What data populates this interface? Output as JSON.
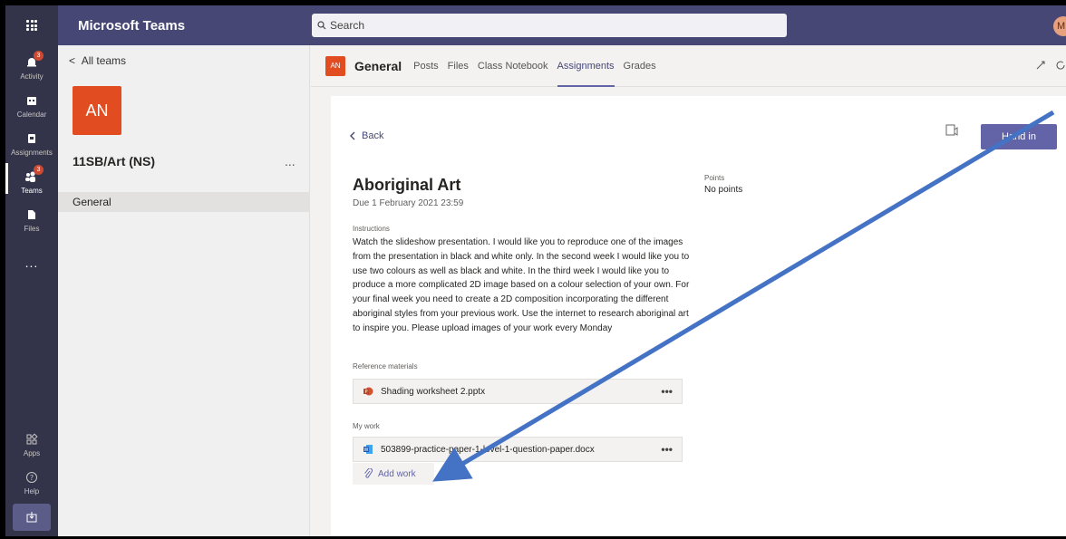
{
  "app": {
    "title": "Microsoft Teams",
    "user_initial": "M"
  },
  "search": {
    "placeholder": "Search"
  },
  "rail": {
    "items": [
      {
        "label": "Activity",
        "icon": "bell-icon",
        "badge": "3"
      },
      {
        "label": "Calendar",
        "icon": "calendar-icon"
      },
      {
        "label": "Assignments",
        "icon": "assignments-icon"
      },
      {
        "label": "Teams",
        "icon": "teams-icon",
        "badge": "3"
      },
      {
        "label": "Files",
        "icon": "files-icon"
      },
      {
        "label": "Apps",
        "icon": "apps-icon"
      },
      {
        "label": "Help",
        "icon": "help-icon"
      }
    ],
    "more": "...",
    "download_icon": "download-icon"
  },
  "team_panel": {
    "back_label": "All teams",
    "avatar": "AN",
    "team_name": "11SB/Art (NS)",
    "more": "...",
    "channel": "General"
  },
  "channel_header": {
    "avatar": "AN",
    "title": "General",
    "tabs": [
      "Posts",
      "Files",
      "Class Notebook",
      "Assignments",
      "Grades"
    ],
    "active_tab": "Assignments"
  },
  "assignment": {
    "back_label": "Back",
    "hand_in_label": "Hand in",
    "title": "Aboriginal Art",
    "due": "Due 1 February 2021 23:59",
    "points_label": "Points",
    "points_value": "No points",
    "instructions_label": "Instructions",
    "instructions": "Watch the slideshow presentation. I would like you to reproduce one of the images from the presentation in black and white only. In the second week I would like you to use  two colours as well as black and white. In the third week I would like you to produce a more complicated 2D image based on a colour selection of your own.  For your final week you need to create a 2D composition incorporating the different aboriginal styles from your previous work. Use the internet to research aboriginal art to inspire you. Please upload images of your work every Monday",
    "reference_label": "Reference materials",
    "reference_file": "Shading worksheet 2.pptx",
    "my_work_label": "My work",
    "my_work_file": "503899-practice-paper-1-level-1-question-paper.docx",
    "add_work_label": "Add work",
    "file_more": "•••"
  },
  "colors": {
    "brand": "#464775",
    "accent": "#6264a7",
    "team_avatar": "#e14d20",
    "annotation_arrow": "#4472c4"
  }
}
